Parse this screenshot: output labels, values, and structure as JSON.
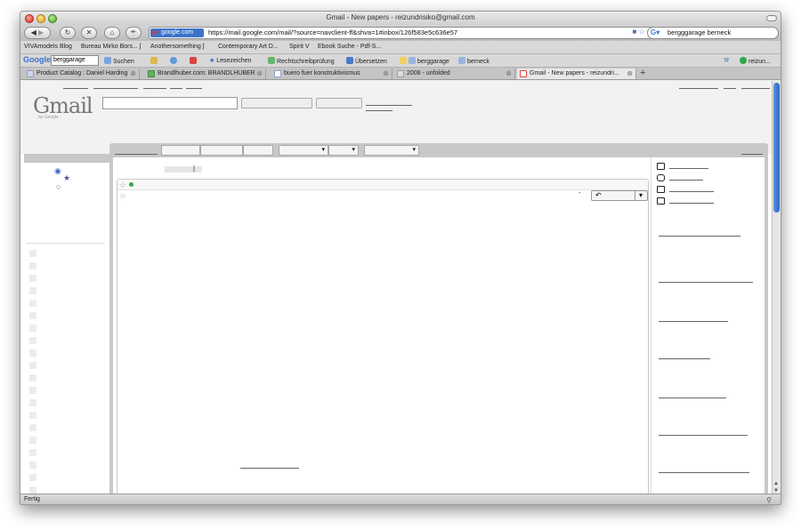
{
  "window": {
    "title": "Gmail - New papers - reizundrisiko@gmail.com"
  },
  "nav": {
    "site_badge": "google.com",
    "url": "https://mail.google.com/mail/?source=navclient-ff&shva=1#inbox/126f583e5c636e57",
    "search_text": "bergggarage berneck"
  },
  "bookmarks": [
    {
      "label": "VIVAmodels Blog"
    },
    {
      "label": "Bureau Mirko Bors... ʃ"
    },
    {
      "label": "Anothersomething ʃ"
    },
    {
      "label": "Contemporary Art D..."
    },
    {
      "label": "Spirit V"
    },
    {
      "label": "Ebook Suche - Pdf-S..."
    }
  ],
  "google_toolbar": {
    "logo": "Google",
    "input": "berggarage",
    "suchen": "Suchen",
    "lesezeichen": "Lesezeichen",
    "rechtschreib": "Rechtschreibprüfung",
    "uebersetzen": "Übersetzen",
    "berggarage": "berggarage",
    "berneck": "berneck",
    "user": "reizun..."
  },
  "tabs": [
    {
      "label": "Product Catalog : Daniel Harding"
    },
    {
      "label": "Brandlhuber.com: BRANDLHUBER"
    },
    {
      "label": "buero fuer konstruktivismus"
    },
    {
      "label": "2008 - unfolded"
    },
    {
      "label": "Gmail - New papers - reizundri..."
    }
  ],
  "gmail": {
    "logo": "Gmail",
    "logo_sub": "by Google",
    "subject_cursor": "|",
    "reply_arrow": "↶",
    "reply_dropdown": "▾",
    "select_arrow": "▾",
    "small_dash": "-"
  },
  "status": {
    "text": "Fertig"
  }
}
